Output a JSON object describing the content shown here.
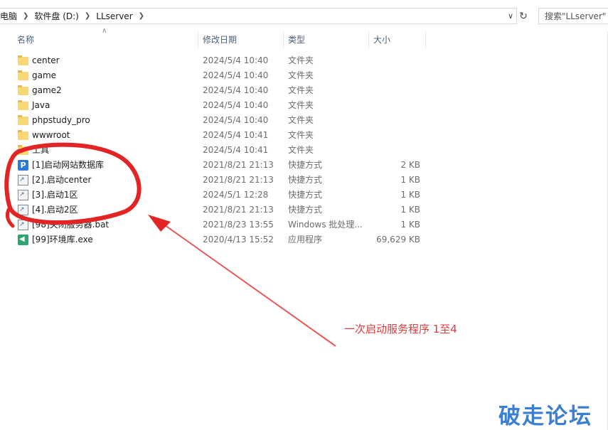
{
  "address": {
    "breadcrumbs": [
      "此电脑",
      "软件盘 (D:)",
      "LLserver"
    ],
    "search_placeholder": "搜索\"LLserver\""
  },
  "columns": {
    "name": "名称",
    "date": "修改日期",
    "type": "类型",
    "size": "大小"
  },
  "files": [
    {
      "name": "center",
      "date": "2024/5/4 10:40",
      "type": "文件夹",
      "size": "",
      "icon": "folder-icon"
    },
    {
      "name": "game",
      "date": "2024/5/4 10:40",
      "type": "文件夹",
      "size": "",
      "icon": "folder-icon"
    },
    {
      "name": "game2",
      "date": "2024/5/4 10:40",
      "type": "文件夹",
      "size": "",
      "icon": "folder-icon"
    },
    {
      "name": "Java",
      "date": "2024/5/4 10:40",
      "type": "文件夹",
      "size": "",
      "icon": "folder-icon"
    },
    {
      "name": "phpstudy_pro",
      "date": "2024/5/4 10:40",
      "type": "文件夹",
      "size": "",
      "icon": "folder-icon"
    },
    {
      "name": "wwwroot",
      "date": "2024/5/4 10:41",
      "type": "文件夹",
      "size": "",
      "icon": "folder-icon"
    },
    {
      "name": "工具",
      "date": "2024/5/4 10:41",
      "type": "文件夹",
      "size": "",
      "icon": "folder-icon"
    },
    {
      "name": "[1]启动网站数据库",
      "date": "2021/8/21 21:13",
      "type": "快捷方式",
      "size": "2 KB",
      "icon": "phpstudy-icon"
    },
    {
      "name": "[2].启动center",
      "date": "2021/8/21 21:13",
      "type": "快捷方式",
      "size": "1 KB",
      "icon": "shortcut-icon"
    },
    {
      "name": "[3].启动1区",
      "date": "2024/5/1 12:28",
      "type": "快捷方式",
      "size": "1 KB",
      "icon": "shortcut-icon"
    },
    {
      "name": "[4].启动2区",
      "date": "2021/8/21 21:13",
      "type": "快捷方式",
      "size": "1 KB",
      "icon": "shortcut-icon"
    },
    {
      "name": "[98]关闭服务器.bat",
      "date": "2021/8/23 13:55",
      "type": "Windows 批处理...",
      "size": "1 KB",
      "icon": "batch-file-icon"
    },
    {
      "name": "[99]环境库.exe",
      "date": "2020/4/13 15:52",
      "type": "应用程序",
      "size": "69,629 KB",
      "icon": "executable-icon"
    }
  ],
  "annotation": {
    "text": "一次启动服务程序 1至4",
    "color": "#e03a3a"
  },
  "watermark": "破走论坛"
}
